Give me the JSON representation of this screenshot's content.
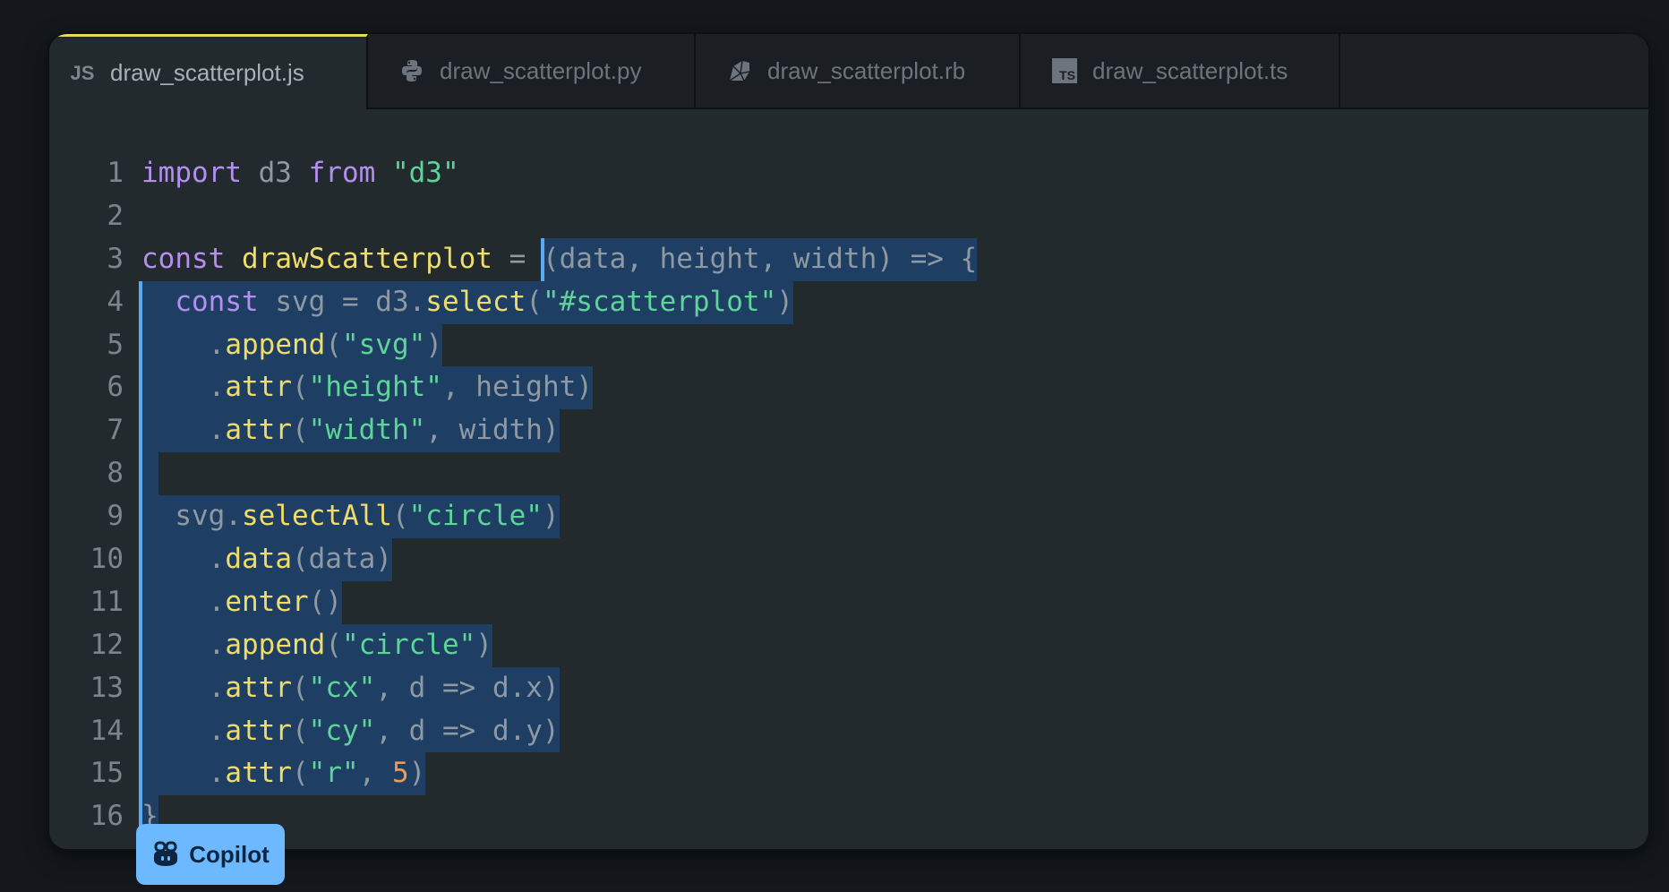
{
  "tabs": [
    {
      "label": "draw_scatterplot.js",
      "icon": "javascript-icon",
      "icon_text": "JS",
      "active": true
    },
    {
      "label": "draw_scatterplot.py",
      "icon": "python-icon",
      "active": false
    },
    {
      "label": "draw_scatterplot.rb",
      "icon": "ruby-icon",
      "active": false
    },
    {
      "label": "draw_scatterplot.ts",
      "icon": "typescript-icon",
      "icon_text": "TS",
      "active": false
    }
  ],
  "colors": {
    "active_tab_accent": "#e6d85a",
    "selection": "#1e3f63",
    "selection_bar": "#5aa9f2",
    "keyword": "#b48ef0",
    "function": "#eedd6a",
    "string": "#5ed49a",
    "number": "#f19a55",
    "copilot_badge": "#6db9ff"
  },
  "code": {
    "lines": [
      {
        "n": "1",
        "tokens": [
          [
            "kw",
            "import"
          ],
          [
            "pl",
            " d3 "
          ],
          [
            "kw",
            "from"
          ],
          [
            "pl",
            " "
          ],
          [
            "str",
            "\"d3\""
          ]
        ]
      },
      {
        "n": "2",
        "tokens": []
      },
      {
        "n": "3",
        "tokens": [
          [
            "kw",
            "const"
          ],
          [
            "pl",
            " "
          ],
          [
            "fn",
            "drawScatterplot"
          ],
          [
            "pl",
            " = "
          ]
        ],
        "sel_tokens": [
          [
            "pl",
            "(data, height, width) => {"
          ]
        ]
      },
      {
        "n": "4",
        "tokens": [],
        "sel_tokens": [
          [
            "pl",
            "  "
          ],
          [
            "kw",
            "const"
          ],
          [
            "pl",
            " svg = d3."
          ],
          [
            "fn",
            "select"
          ],
          [
            "pl",
            "("
          ],
          [
            "str",
            "\"#scatterplot\""
          ],
          [
            "pl",
            ")"
          ]
        ]
      },
      {
        "n": "5",
        "tokens": [],
        "sel_tokens": [
          [
            "pl",
            "    ."
          ],
          [
            "fn",
            "append"
          ],
          [
            "pl",
            "("
          ],
          [
            "str",
            "\"svg\""
          ],
          [
            "pl",
            ")"
          ]
        ]
      },
      {
        "n": "6",
        "tokens": [],
        "sel_tokens": [
          [
            "pl",
            "    ."
          ],
          [
            "fn",
            "attr"
          ],
          [
            "pl",
            "("
          ],
          [
            "str",
            "\"height\""
          ],
          [
            "pl",
            ", height)"
          ]
        ]
      },
      {
        "n": "7",
        "tokens": [],
        "sel_tokens": [
          [
            "pl",
            "    ."
          ],
          [
            "fn",
            "attr"
          ],
          [
            "pl",
            "("
          ],
          [
            "str",
            "\"width\""
          ],
          [
            "pl",
            ", width)"
          ]
        ]
      },
      {
        "n": "8",
        "tokens": [],
        "sel_tokens": []
      },
      {
        "n": "9",
        "tokens": [],
        "sel_tokens": [
          [
            "pl",
            "  svg."
          ],
          [
            "fn",
            "selectAll"
          ],
          [
            "pl",
            "("
          ],
          [
            "str",
            "\"circle\""
          ],
          [
            "pl",
            ")"
          ]
        ]
      },
      {
        "n": "10",
        "tokens": [],
        "sel_tokens": [
          [
            "pl",
            "    ."
          ],
          [
            "fn",
            "data"
          ],
          [
            "pl",
            "(data)"
          ]
        ]
      },
      {
        "n": "11",
        "tokens": [],
        "sel_tokens": [
          [
            "pl",
            "    ."
          ],
          [
            "fn",
            "enter"
          ],
          [
            "pl",
            "()"
          ]
        ]
      },
      {
        "n": "12",
        "tokens": [],
        "sel_tokens": [
          [
            "pl",
            "    ."
          ],
          [
            "fn",
            "append"
          ],
          [
            "pl",
            "("
          ],
          [
            "str",
            "\"circle\""
          ],
          [
            "pl",
            ")"
          ]
        ]
      },
      {
        "n": "13",
        "tokens": [],
        "sel_tokens": [
          [
            "pl",
            "    ."
          ],
          [
            "fn",
            "attr"
          ],
          [
            "pl",
            "("
          ],
          [
            "str",
            "\"cx\""
          ],
          [
            "pl",
            ", d => d.x)"
          ]
        ]
      },
      {
        "n": "14",
        "tokens": [],
        "sel_tokens": [
          [
            "pl",
            "    ."
          ],
          [
            "fn",
            "attr"
          ],
          [
            "pl",
            "("
          ],
          [
            "str",
            "\"cy\""
          ],
          [
            "pl",
            ", d => d.y)"
          ]
        ]
      },
      {
        "n": "15",
        "tokens": [],
        "sel_tokens": [
          [
            "pl",
            "    ."
          ],
          [
            "fn",
            "attr"
          ],
          [
            "pl",
            "("
          ],
          [
            "str",
            "\"r\""
          ],
          [
            "pl",
            ", "
          ],
          [
            "num",
            "5"
          ],
          [
            "pl",
            ")"
          ]
        ]
      },
      {
        "n": "16",
        "tokens": [],
        "sel_tokens": [
          [
            "pl",
            "}"
          ]
        ]
      }
    ]
  },
  "copilot": {
    "label": "Copilot",
    "icon": "copilot-icon"
  }
}
